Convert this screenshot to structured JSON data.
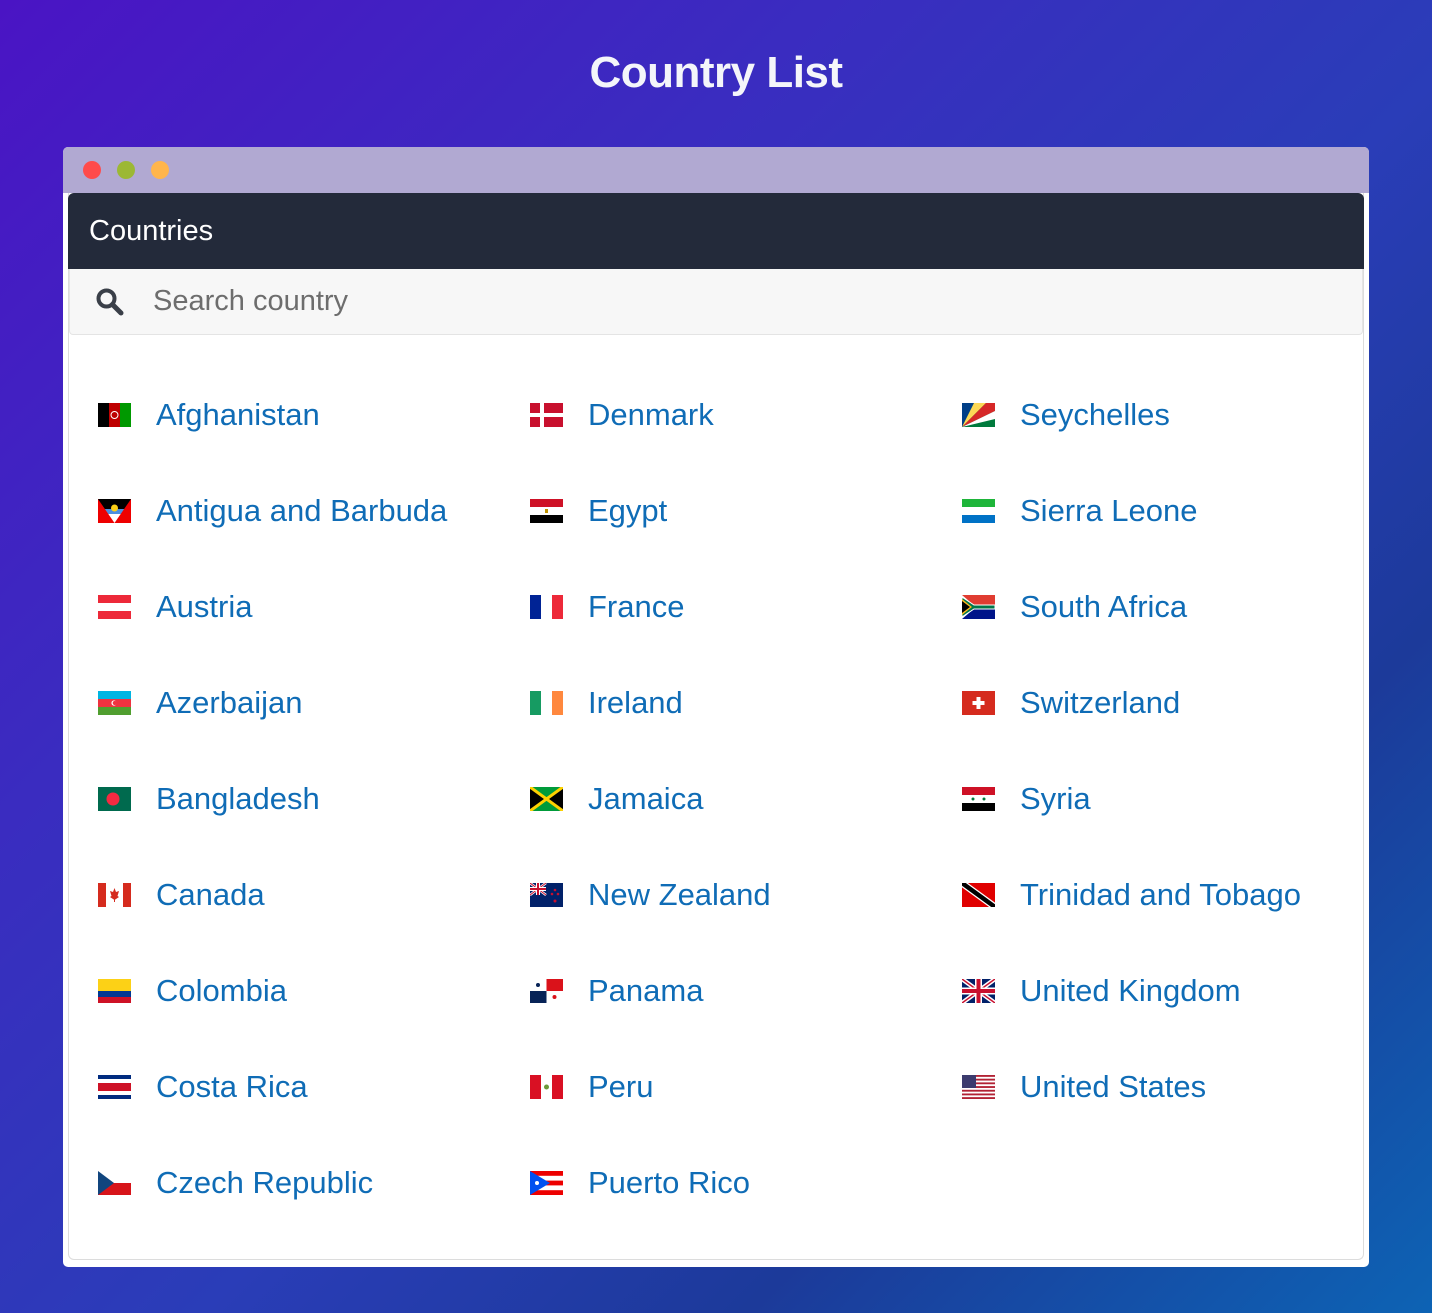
{
  "page": {
    "title": "Country List"
  },
  "window": {
    "controls": [
      {
        "name": "close",
        "color": "#ff4b4b"
      },
      {
        "name": "minimize",
        "color": "#9cb834"
      },
      {
        "name": "maximize",
        "color": "#ffb54c"
      }
    ]
  },
  "card": {
    "header": "Countries",
    "search": {
      "placeholder": "Search country",
      "value": "",
      "icon": "search-icon"
    }
  },
  "colors": {
    "link": "#0f6cb6",
    "header_bg": "#232a3a",
    "titlebar": "#b1a9d2"
  },
  "countries": [
    {
      "name": "Afghanistan",
      "flag": "af"
    },
    {
      "name": "Antigua and Barbuda",
      "flag": "ag"
    },
    {
      "name": "Austria",
      "flag": "at"
    },
    {
      "name": "Azerbaijan",
      "flag": "az"
    },
    {
      "name": "Bangladesh",
      "flag": "bd"
    },
    {
      "name": "Canada",
      "flag": "ca"
    },
    {
      "name": "Colombia",
      "flag": "co"
    },
    {
      "name": "Costa Rica",
      "flag": "cr"
    },
    {
      "name": "Czech Republic",
      "flag": "cz"
    },
    {
      "name": "Denmark",
      "flag": "dk"
    },
    {
      "name": "Egypt",
      "flag": "eg"
    },
    {
      "name": "France",
      "flag": "fr"
    },
    {
      "name": "Ireland",
      "flag": "ie"
    },
    {
      "name": "Jamaica",
      "flag": "jm"
    },
    {
      "name": "New Zealand",
      "flag": "nz"
    },
    {
      "name": "Panama",
      "flag": "pa"
    },
    {
      "name": "Peru",
      "flag": "pe"
    },
    {
      "name": "Puerto Rico",
      "flag": "pr"
    },
    {
      "name": "Seychelles",
      "flag": "sc"
    },
    {
      "name": "Sierra Leone",
      "flag": "sl"
    },
    {
      "name": "South Africa",
      "flag": "za"
    },
    {
      "name": "Switzerland",
      "flag": "ch"
    },
    {
      "name": "Syria",
      "flag": "sy"
    },
    {
      "name": "Trinidad and Tobago",
      "flag": "tt"
    },
    {
      "name": "United Kingdom",
      "flag": "gb"
    },
    {
      "name": "United States",
      "flag": "us"
    }
  ]
}
